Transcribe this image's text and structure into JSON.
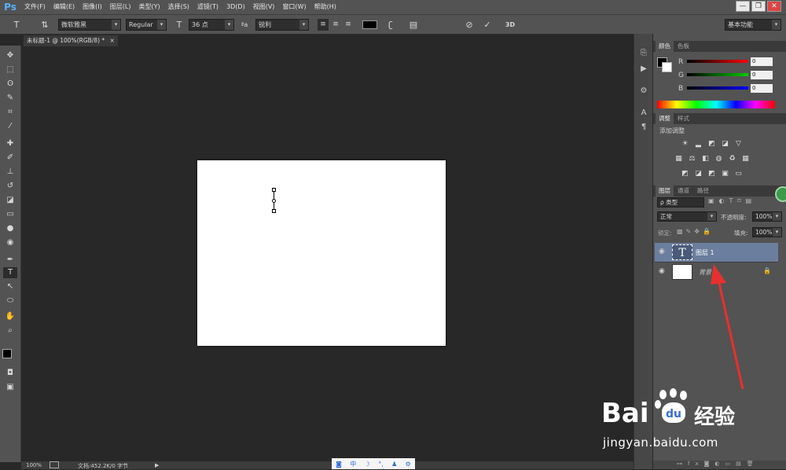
{
  "app": {
    "logo": "Ps"
  },
  "menu": [
    "文件(F)",
    "编辑(E)",
    "图像(I)",
    "图层(L)",
    "类型(Y)",
    "选择(S)",
    "滤镜(T)",
    "3D(D)",
    "视图(V)",
    "窗口(W)",
    "帮助(H)"
  ],
  "window": {
    "min": "—",
    "restore": "❐",
    "close": "✕"
  },
  "options": {
    "font_family": "微软雅黑",
    "font_style": "Regular",
    "font_size": "36 点",
    "aa_label": "ªa",
    "aa_mode": "锐利",
    "workspace": "基本功能",
    "btn_3d": "3D",
    "text_color": "#000000"
  },
  "document": {
    "tab_title": "未标题-1 @ 100%(RGB/8) *",
    "tab_close": "×"
  },
  "status": {
    "zoom": "100%",
    "doc_info": "文档:452.2K/0 字节",
    "arrow": "▶"
  },
  "ime": [
    "中"
  ],
  "color_panel": {
    "tabs": [
      "颜色",
      "色板"
    ],
    "channels": [
      {
        "label": "R",
        "value": "0"
      },
      {
        "label": "G",
        "value": "0"
      },
      {
        "label": "B",
        "value": "0"
      }
    ]
  },
  "adjust_panel": {
    "tabs": [
      "调整",
      "样式"
    ],
    "title": "添加调整"
  },
  "layers_panel": {
    "tabs": [
      "图层",
      "通道",
      "路径"
    ],
    "filter": "ρ 类型",
    "blend_mode": "正常",
    "opacity_label": "不透明度:",
    "opacity": "100%",
    "lock_label": "锁定:",
    "fill_label": "填充:",
    "fill": "100%",
    "layers": [
      {
        "name": "图层 1",
        "type": "text",
        "selected": true
      },
      {
        "name": "背景",
        "type": "bg",
        "locked": true
      }
    ]
  },
  "watermark": {
    "brand": "Bai",
    "brand2": "经验",
    "url": "jingyan.baidu.com"
  }
}
